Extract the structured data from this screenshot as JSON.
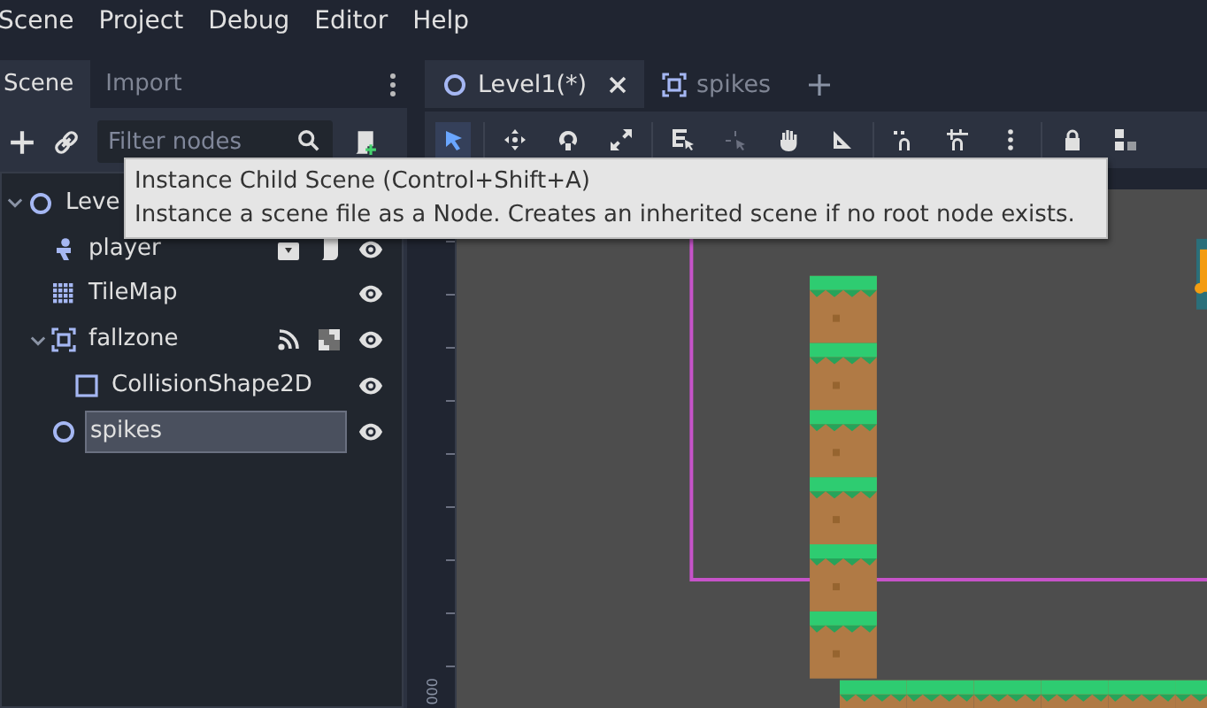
{
  "menu": [
    "Scene",
    "Project",
    "Debug",
    "Editor",
    "Help"
  ],
  "dock": {
    "tabs": [
      {
        "label": "Scene",
        "selected": true
      },
      {
        "label": "Import",
        "selected": false
      }
    ],
    "filter": {
      "placeholder": "Filter nodes"
    },
    "tree": [
      {
        "name": "Leve",
        "kind": "node2d",
        "expanded": true,
        "selected": false,
        "children": [
          {
            "name": "player",
            "kind": "character",
            "selected": false,
            "visible": true,
            "instanced": true,
            "script": true
          },
          {
            "name": "TileMap",
            "kind": "tilemap",
            "selected": false,
            "visible": true
          },
          {
            "name": "fallzone",
            "kind": "area",
            "expanded": true,
            "selected": false,
            "visible": true,
            "signals": true,
            "groups": true,
            "children": [
              {
                "name": "CollisionShape2D",
                "kind": "shape",
                "selected": false,
                "visible": true
              }
            ]
          },
          {
            "name": "spikes",
            "kind": "node2d",
            "selected": true,
            "visible": true
          }
        ]
      }
    ]
  },
  "tooltip": {
    "title": "Instance Child Scene (Control+Shift+A)",
    "text": "Instance a scene file as a Node. Creates an inherited scene if no root node exists."
  },
  "editor_tabs": [
    {
      "label": "Level1(*)",
      "kind": "node2d",
      "selected": true
    },
    {
      "label": "spikes",
      "kind": "area",
      "selected": false
    }
  ],
  "tools": [
    {
      "kind": "select",
      "selected": true,
      "disabled": false
    },
    {
      "kind": "move",
      "selected": false,
      "disabled": false
    },
    {
      "kind": "rotate",
      "selected": false,
      "disabled": false
    },
    {
      "kind": "scale",
      "selected": false,
      "disabled": false
    },
    {
      "kind": "list",
      "selected": false,
      "disabled": false
    },
    {
      "kind": "pivot",
      "selected": false,
      "disabled": true
    },
    {
      "kind": "pan",
      "selected": false,
      "disabled": false
    },
    {
      "kind": "ruler",
      "selected": false,
      "disabled": false
    },
    {
      "kind": "snap",
      "selected": false,
      "disabled": false
    },
    {
      "kind": "gridsnap",
      "selected": false,
      "disabled": false
    },
    {
      "kind": "more",
      "selected": false,
      "disabled": false
    },
    {
      "kind": "lock",
      "selected": false,
      "disabled": false
    },
    {
      "kind": "group",
      "selected": false,
      "disabled": false
    }
  ],
  "ruler_label": "000"
}
